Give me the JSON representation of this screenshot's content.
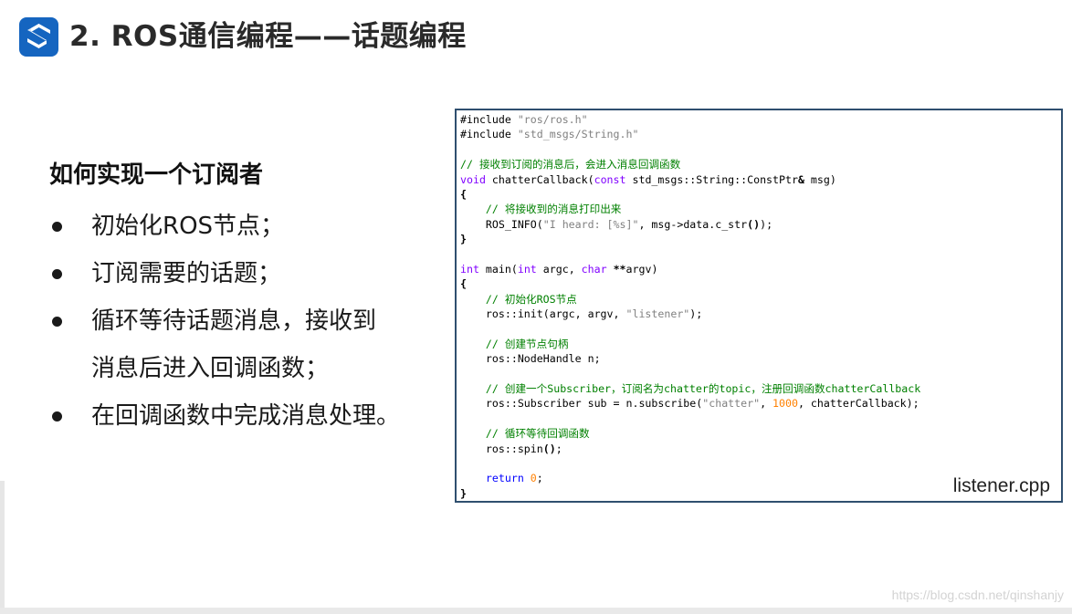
{
  "header": {
    "title": "2. ROS通信编程——话题编程",
    "logo_icon": "s-logo-icon"
  },
  "intro": {
    "heading": "如何实现一个订阅者",
    "bullets": [
      [
        "初始化ROS节点；"
      ],
      [
        "订阅需要的话题；"
      ],
      [
        "循环等待话题消息，接收到",
        "消息后进入回调函数；"
      ],
      [
        "在回调函数中完成消息处理。"
      ]
    ]
  },
  "code_panel": {
    "filename": "listener.cpp",
    "lines": [
      [
        [
          "pp",
          "#include "
        ],
        [
          "str",
          "\"ros/ros.h\""
        ]
      ],
      [
        [
          "pp",
          "#include "
        ],
        [
          "str",
          "\"std_msgs/String.h\""
        ]
      ],
      [],
      [
        [
          "cm",
          "// 接收到订阅的消息后，会进入消息回调函数"
        ]
      ],
      [
        [
          "type",
          "void"
        ],
        [
          "",
          " chatterCallback("
        ],
        [
          "type",
          "const"
        ],
        [
          "",
          " std_msgs::String::ConstPtr"
        ],
        [
          "bold",
          "&"
        ],
        [
          "",
          " msg)"
        ]
      ],
      [
        [
          "bold",
          "{"
        ]
      ],
      [
        [
          "",
          "    "
        ],
        [
          "cm",
          "// 将接收到的消息打印出来"
        ]
      ],
      [
        [
          "",
          "    ROS_INFO("
        ],
        [
          "str",
          "\"I heard: [%s]\""
        ],
        [
          "",
          ", msg->data.c_str"
        ],
        [
          "bold",
          "()"
        ],
        [
          "",
          ");"
        ]
      ],
      [
        [
          "bold",
          "}"
        ]
      ],
      [],
      [
        [
          "type",
          "int"
        ],
        [
          "",
          " main("
        ],
        [
          "type",
          "int"
        ],
        [
          "",
          " argc, "
        ],
        [
          "type",
          "char"
        ],
        [
          "",
          " "
        ],
        [
          "bold",
          "**"
        ],
        [
          "",
          "argv)"
        ]
      ],
      [
        [
          "bold",
          "{"
        ]
      ],
      [
        [
          "",
          "    "
        ],
        [
          "cm",
          "// 初始化ROS节点"
        ]
      ],
      [
        [
          "",
          "    ros::init(argc, argv, "
        ],
        [
          "str",
          "\"listener\""
        ],
        [
          "",
          ");"
        ]
      ],
      [],
      [
        [
          "",
          "    "
        ],
        [
          "cm",
          "// 创建节点句柄"
        ]
      ],
      [
        [
          "",
          "    ros::NodeHandle n;"
        ]
      ],
      [],
      [
        [
          "",
          "    "
        ],
        [
          "cm",
          "// 创建一个Subscriber，订阅名为chatter的topic，注册回调函数chatterCallback"
        ]
      ],
      [
        [
          "",
          "    ros::Subscriber sub = n.subscribe("
        ],
        [
          "str",
          "\"chatter\""
        ],
        [
          "",
          ", "
        ],
        [
          "num",
          "1000"
        ],
        [
          "",
          ", chatterCallback);"
        ]
      ],
      [],
      [
        [
          "",
          "    "
        ],
        [
          "cm",
          "// 循环等待回调函数"
        ]
      ],
      [
        [
          "",
          "    ros::spin"
        ],
        [
          "bold",
          "()"
        ],
        [
          "",
          ";"
        ]
      ],
      [],
      [
        [
          "",
          "    "
        ],
        [
          "kw",
          "return"
        ],
        [
          "",
          " "
        ],
        [
          "num",
          "0"
        ],
        [
          "",
          ";"
        ]
      ],
      [
        [
          "bold",
          "}"
        ]
      ]
    ]
  },
  "footer": {
    "watermark": "https://blog.csdn.net/qinshanjy"
  },
  "colors": {
    "logo_bg": "#1565c0",
    "code_border": "#2f4f6f",
    "comment": "#008000",
    "string": "#808080",
    "keyword": "#0000ff",
    "type": "#8000ff",
    "number": "#ff8000"
  }
}
